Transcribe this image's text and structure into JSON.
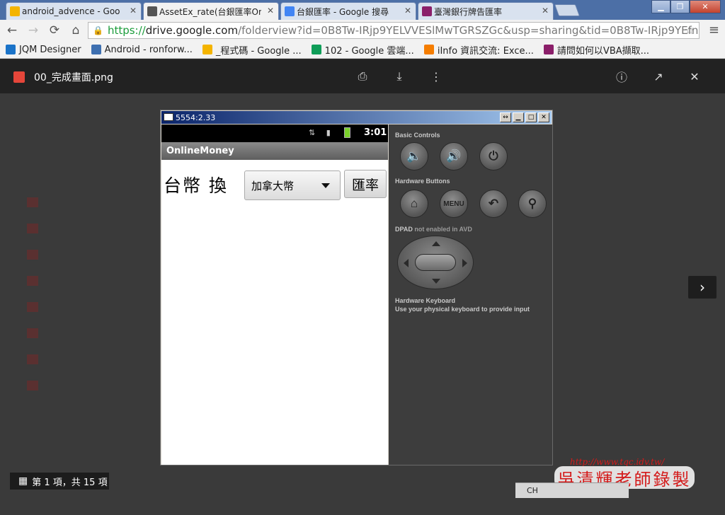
{
  "browser": {
    "tabs": [
      {
        "label": "android_advence - Goo",
        "icon_color": "#f4b400"
      },
      {
        "label": "AssetEx_rate(台銀匯率On",
        "icon_color": "#555555",
        "active": true
      },
      {
        "label": "台銀匯率 - Google 搜尋",
        "icon_color": "#4285f4"
      },
      {
        "label": "臺灣銀行牌告匯率",
        "icon_color": "#8b1f6a"
      }
    ],
    "tab_close_glyph": "✕",
    "window_buttons": {
      "minimize": "▁",
      "maximize": "❐",
      "close": "✕"
    },
    "nav": {
      "back_glyph": "←",
      "forward_glyph": "→",
      "reload_glyph": "⟳",
      "home_glyph": "⌂"
    },
    "url": {
      "scheme": "https://",
      "host": "drive.google.com",
      "rest": "/folderview?id=0B8Tw-IRjp9YELVVESlMwTGRSZGc&usp=sharing&tid=0B8Tw-IRjp9YEfnNv"
    },
    "star_glyph": "☆",
    "menu_glyph": "≡",
    "bookmarks": [
      {
        "label": "JQM Designer",
        "icon_color": "#1a73c8"
      },
      {
        "label": "Android - ronforw...",
        "icon_color": "#3d6fb0"
      },
      {
        "label": "_程式碼 - Google ...",
        "icon_color": "#f4b400"
      },
      {
        "label": "102 - Google 雲端...",
        "icon_color": "#0f9d58"
      },
      {
        "label": "iInfo 資訊交流: Exce...",
        "icon_color": "#f57d00"
      },
      {
        "label": "請問如何以VBA擷取...",
        "icon_color": "#8b1f6a"
      }
    ]
  },
  "viewer": {
    "filename": "00_完成畫面.png",
    "print_glyph": "⎙",
    "download_glyph": "⤓",
    "more_glyph": "⋮",
    "info_glyph": "ⓘ",
    "open_glyph": "↗",
    "close_glyph": "✕",
    "next_glyph": "›",
    "pager_glyph": "▦",
    "pager_text": "第 1 項，共 15 項"
  },
  "emulator": {
    "title": "5554:2.33",
    "buttons": {
      "resize": "↔",
      "minimize": "▁",
      "maximize": "□",
      "close": "✕"
    },
    "statusbar": {
      "signal_glyphs": "⇅ ▮",
      "time": "3:01"
    },
    "app_title": "OnlineMoney",
    "label_text": "台幣 換",
    "spinner_value": "加拿大幣",
    "rate_button": "匯率",
    "controls": {
      "basic_controls": "Basic Controls",
      "hardware_buttons": "Hardware Buttons",
      "dpad_label": "DPAD",
      "dpad_note": "not enabled in AVD",
      "hw_keyboard": "Hardware Keyboard",
      "hw_keyboard_note": "Use your physical keyboard to provide input",
      "vol_down_glyph": "🔈",
      "vol_up_glyph": "🔊",
      "power_glyph": "⏻",
      "home_glyph": "⌂",
      "menu_label": "MENU",
      "back_glyph": "↶",
      "search_glyph": "⚲"
    }
  },
  "watermark": {
    "url": "http://www.tqc.idv.tw/",
    "signature": "吳清輝老師錄製"
  },
  "tray": {
    "lang": "CH"
  }
}
